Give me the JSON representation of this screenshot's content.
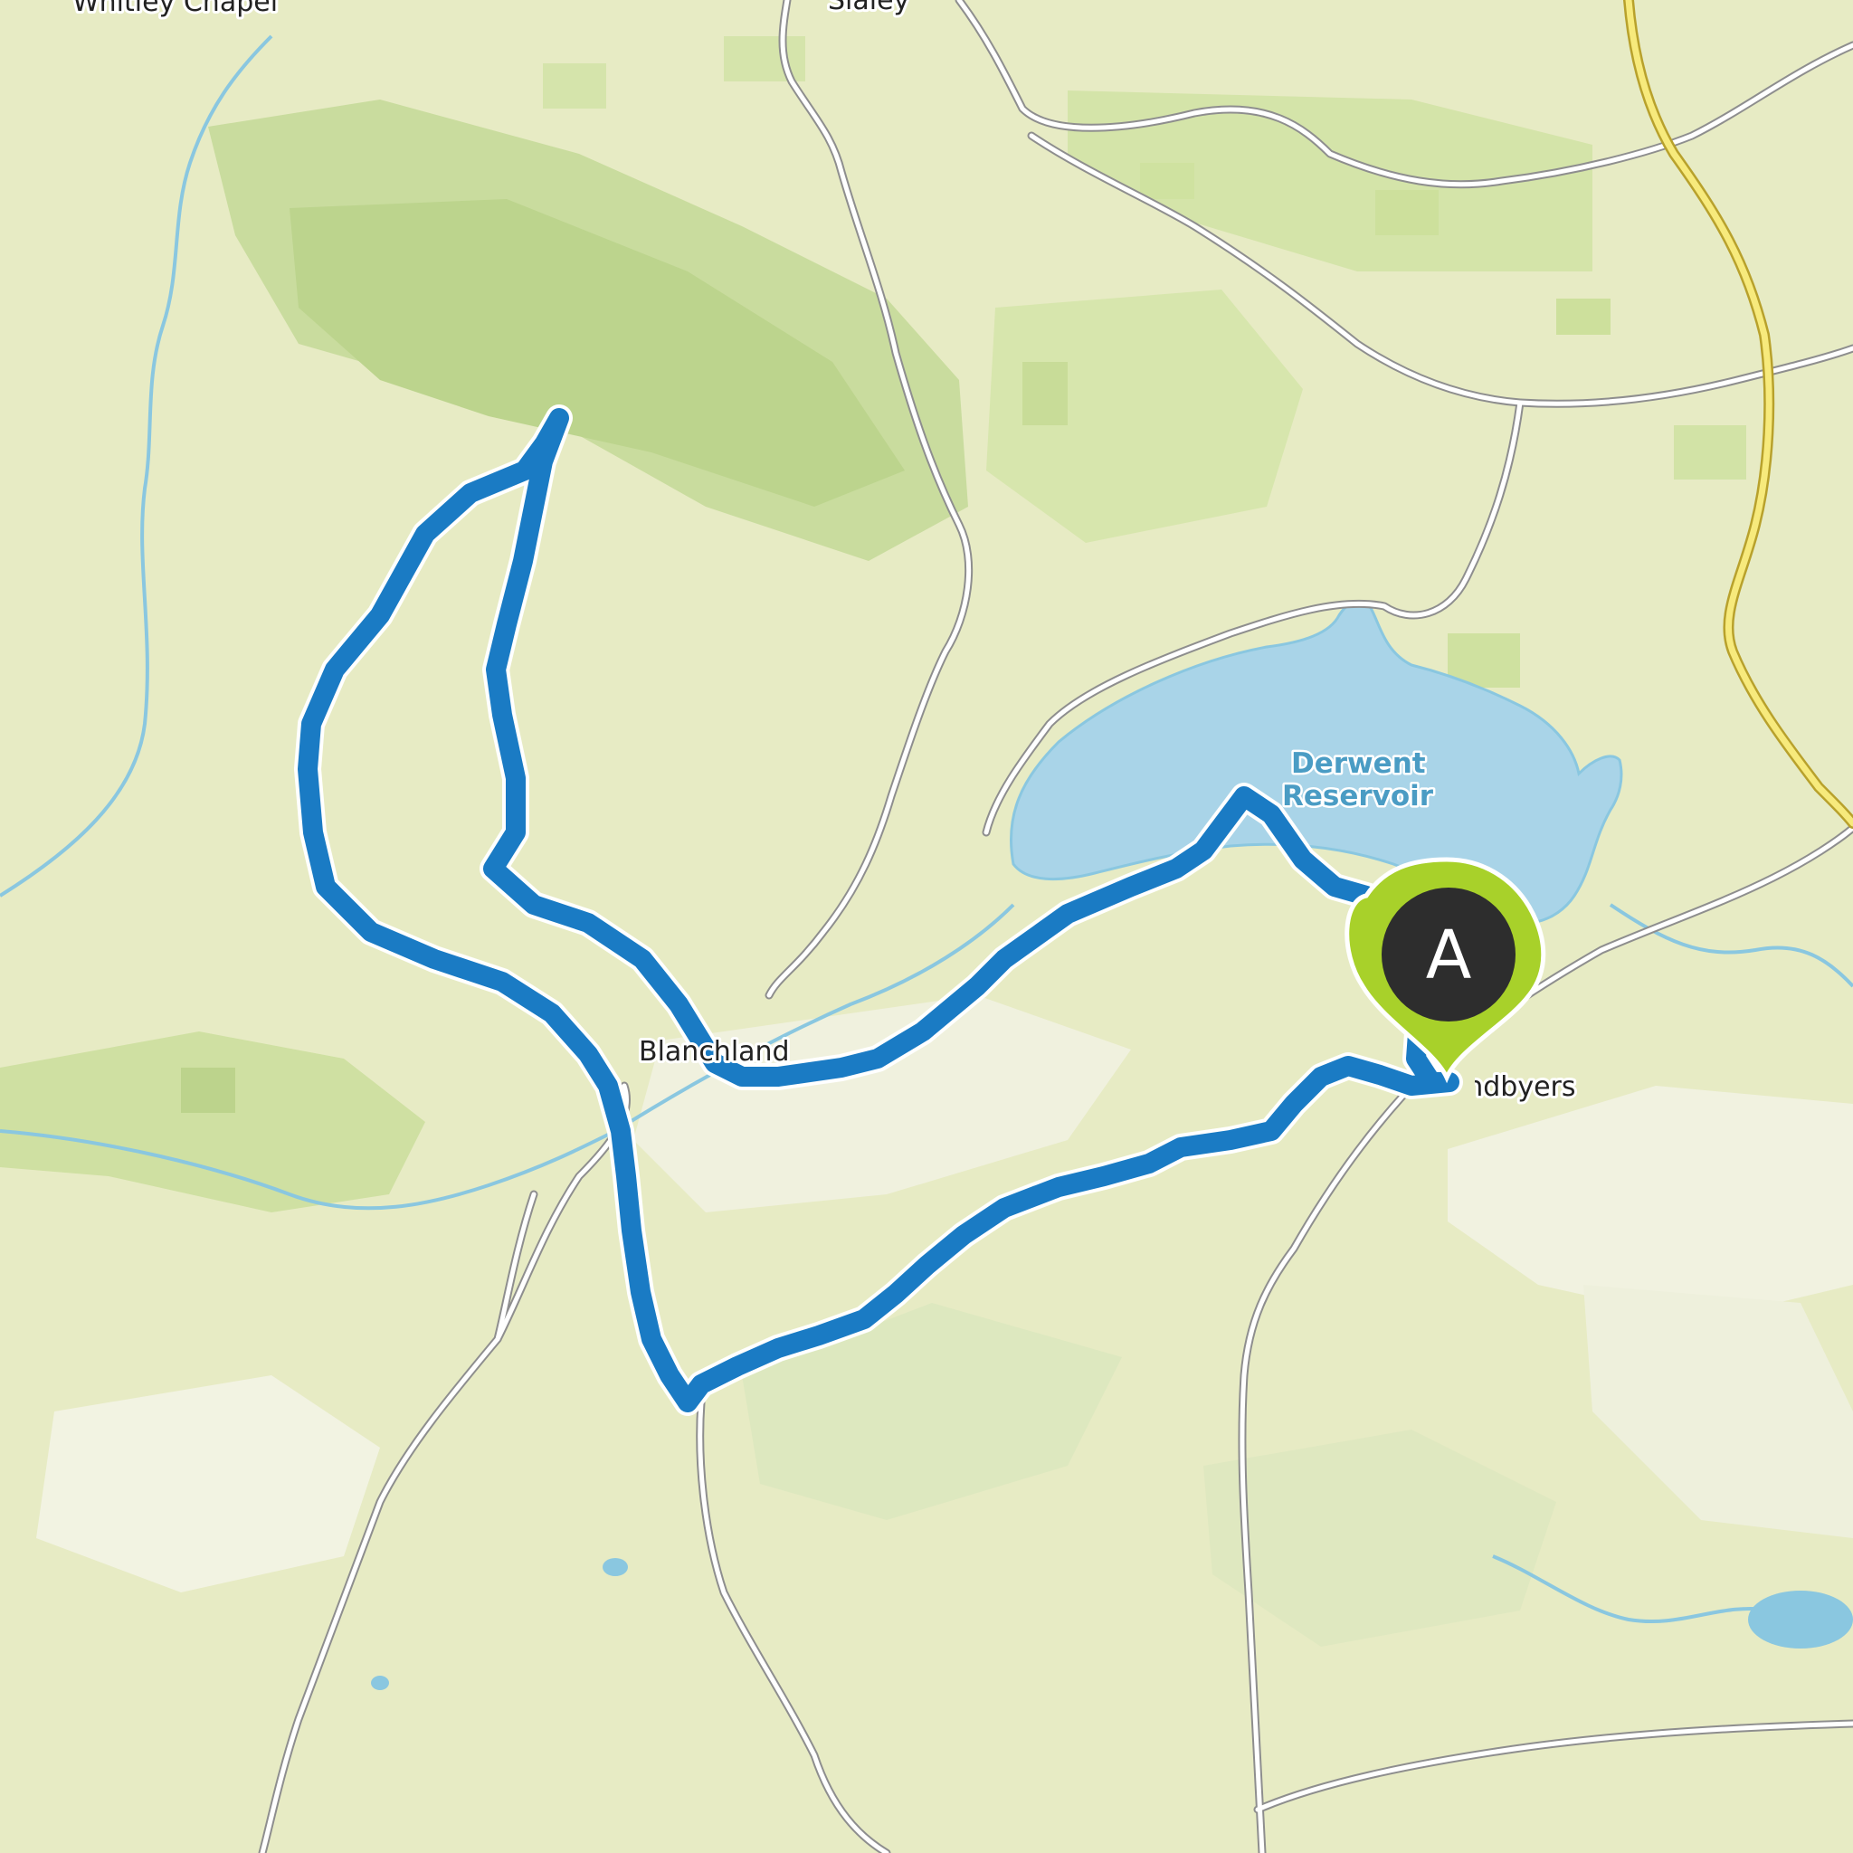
{
  "map": {
    "places": {
      "whitley_chapel": "Whitley Chapel",
      "slaley": "Slaley",
      "blanchland": "Blanchland",
      "edmundbyers": "Edmundbyers"
    },
    "water": {
      "line1": "Derwent",
      "line2": "Reservoir"
    },
    "route": {
      "start_marker": "A",
      "route_color": "#1a7bc4",
      "marker_color": "#a8d12a"
    }
  }
}
